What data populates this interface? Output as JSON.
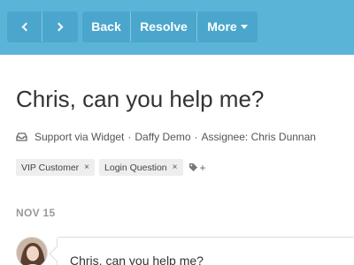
{
  "toolbar": {
    "prev_icon": "chevron-left-icon",
    "next_icon": "chevron-right-icon",
    "back_label": "Back",
    "resolve_label": "Resolve",
    "more_label": "More",
    "bar_color": "#5ab4d8"
  },
  "conversation": {
    "title": "Chris, can you help me?",
    "source": "Support via Widget",
    "company": "Daffy Demo",
    "assignee": "Assignee: Chris Dunnan",
    "separator": "·"
  },
  "tags": [
    {
      "label": "VIP Customer",
      "remove": "×"
    },
    {
      "label": "Login Question",
      "remove": "×"
    }
  ],
  "add_tag_label": "+",
  "date_label": "NOV 15",
  "message": {
    "text": "Chris, can you help me?"
  }
}
